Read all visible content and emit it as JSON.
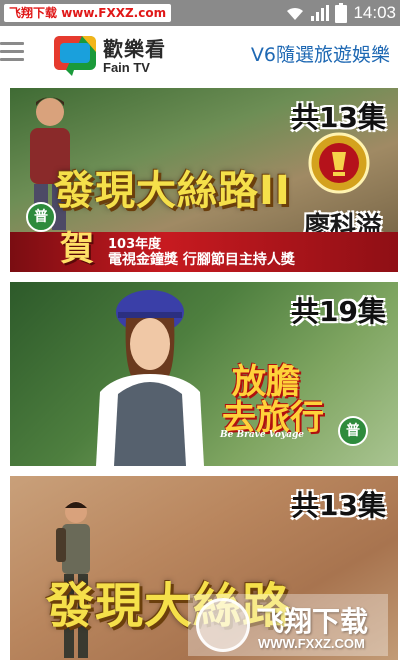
{
  "watermark": {
    "tag_cn": "飞翔下载",
    "tag_url": "www.FXXZ.com",
    "overlay_cn": "飞翔下载",
    "overlay_url": "WWW.FXXZ.COM"
  },
  "status_bar": {
    "time": "14:03",
    "icons": [
      "wifi-icon",
      "signal-icon",
      "battery-icon"
    ]
  },
  "header": {
    "brand_cn": "歡樂看",
    "brand_en": "Fain TV",
    "channel_title": "V6隨選旅遊娛樂"
  },
  "cards": [
    {
      "episodes": "共13集",
      "title": "發現大絲路II",
      "rating": "普",
      "host": "廖科溢",
      "award_he": "賀",
      "award_year": "103年度",
      "award_text": "電視金鐘獎  行腳節目主持人獎"
    },
    {
      "episodes": "共19集",
      "title_line1": "放膽",
      "title_line2": "去旅行",
      "subtitle": "Be Brave Voyage",
      "rating": "普"
    },
    {
      "episodes": "共13集",
      "title": "發現大絲路"
    }
  ],
  "colors": {
    "status_bar": "#8a8a8a",
    "channel_title": "#1e68b3",
    "rating_badge": "#2e8b3c",
    "title_yellow": "#f5e04a"
  }
}
